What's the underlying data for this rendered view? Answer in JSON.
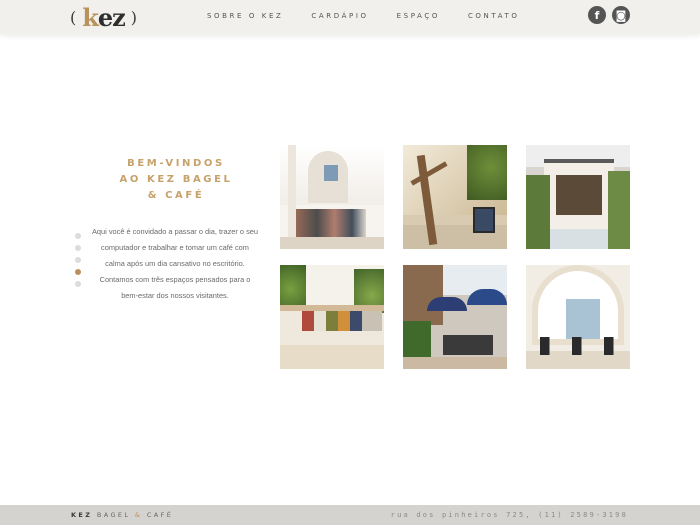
{
  "header": {
    "logo": {
      "open_paren": "(",
      "k": "k",
      "ez": "ez",
      "close_paren": ")"
    },
    "nav": [
      {
        "label": "SOBRE O KEZ"
      },
      {
        "label": "CARDÁPIO"
      },
      {
        "label": "ESPAÇO"
      },
      {
        "label": "CONTATO"
      }
    ],
    "social": [
      {
        "icon": "facebook-icon",
        "glyph": "f"
      },
      {
        "icon": "instagram-icon",
        "glyph": "◙"
      }
    ]
  },
  "welcome": {
    "title_lines": [
      "BEM-VINDOS",
      "AO KEZ BAGEL",
      "& CAFÉ"
    ],
    "body": "Aqui você é convidado a passar o dia, trazer o seu computador e trabalhar e tomar um café com calma após um dia cansativo no escritório. Contamos com três espaços pensados para o bem-estar dos nossos visitantes."
  },
  "slider": {
    "count": 5,
    "active_index": 3
  },
  "gallery": [
    {
      "name": "cafe-interior-photo"
    },
    {
      "name": "garden-tree-photo"
    },
    {
      "name": "storefront-photo"
    },
    {
      "name": "bookshelf-photo"
    },
    {
      "name": "patio-umbrellas-photo"
    },
    {
      "name": "arched-interior-photo"
    }
  ],
  "footer": {
    "brand_kez": "KEZ",
    "brand_bagel": "BAGEL",
    "brand_amp": "&",
    "brand_cafe": "CAFÉ",
    "address": "rua dos pinheiros 725, (11) 2589-3198"
  },
  "colors": {
    "accent": "#c6a26a",
    "text": "#6a6a6a",
    "header_bg": "#f1f0ed",
    "footer_bg": "#d5d3cf"
  }
}
